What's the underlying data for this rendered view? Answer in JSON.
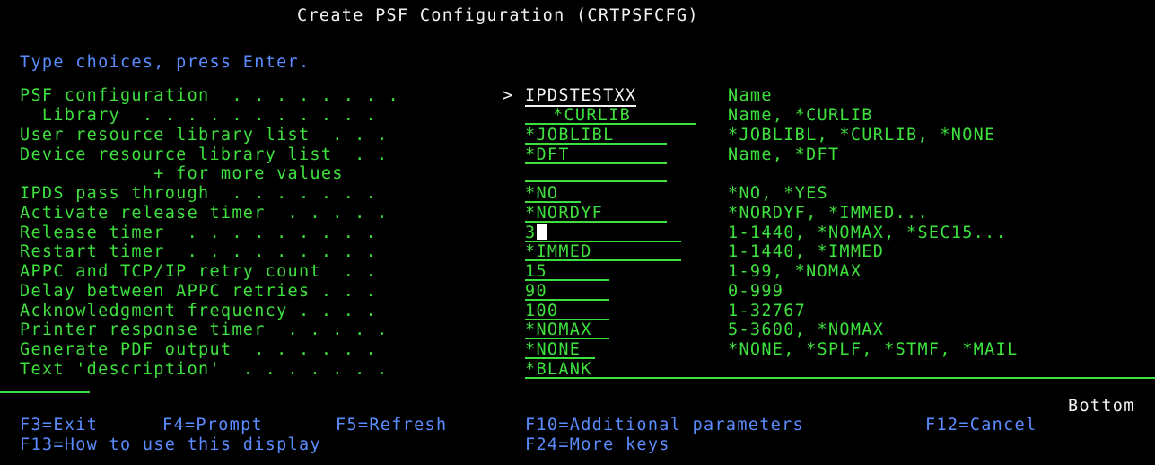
{
  "header": {
    "title": "Create PSF Configuration (CRTPSFCFG)",
    "instruction": "Type choices, press Enter."
  },
  "prompts": [
    {
      "label": "PSF configuration  . . . . . . . .",
      "marker": ">",
      "value": "IPDSTESTXX",
      "hint": "Name"
    },
    {
      "label": "  Library  . . . . . . . . . . .",
      "marker": "",
      "value": "*CURLIB",
      "hint": "Name, *CURLIB"
    },
    {
      "label": "User resource library list  . . .",
      "marker": "",
      "value": "*JOBLIBL",
      "hint": "*JOBLIBL, *CURLIB, *NONE"
    },
    {
      "label": "Device resource library list  . .",
      "marker": "",
      "value": "*DFT",
      "hint": "Name, *DFT"
    },
    {
      "label": "            + for more values",
      "marker": "",
      "value": "",
      "hint": ""
    },
    {
      "label": "IPDS pass through  . . . . . . .",
      "marker": "",
      "value": "*NO",
      "hint": "*NO, *YES"
    },
    {
      "label": "Activate release timer  . . . . .",
      "marker": "",
      "value": "*NORDYF",
      "hint": "*NORDYF, *IMMED..."
    },
    {
      "label": "Release timer  . . . . . . . . .",
      "marker": "",
      "value": "3",
      "hint": "1-1440, *NOMAX, *SEC15..."
    },
    {
      "label": "Restart timer  . . . . . . . . .",
      "marker": "",
      "value": "*IMMED",
      "hint": "1-1440, *IMMED"
    },
    {
      "label": "APPC and TCP/IP retry count  . .",
      "marker": "",
      "value": "15",
      "hint": "1-99, *NOMAX"
    },
    {
      "label": "Delay between APPC retries . . .",
      "marker": "",
      "value": "90",
      "hint": "0-999"
    },
    {
      "label": "Acknowledgment frequency . . . .",
      "marker": "",
      "value": "100",
      "hint": "1-32767"
    },
    {
      "label": "Printer response timer  . . . . .",
      "marker": "",
      "value": "*NOMAX",
      "hint": "5-3600, *NOMAX"
    },
    {
      "label": "Generate PDF output  . . . . . .",
      "marker": "",
      "value": "*NONE",
      "hint": "*NONE, *SPLF, *STMF, *MAIL"
    },
    {
      "label": "Text 'description'  . . . . . . .",
      "marker": "",
      "value": "*BLANK",
      "hint": ""
    }
  ],
  "status": "Bottom",
  "function_keys": {
    "f3": "F3=Exit",
    "f4": "F4=Prompt",
    "f5": "F5=Refresh",
    "f10": "F10=Additional parameters",
    "f12": "F12=Cancel",
    "f13": "F13=How to use this display",
    "f24": "F24=More keys"
  },
  "colors": {
    "background": "#000000",
    "text": "#3ee03e",
    "label": "#5b8cff",
    "title": "#f2f2f2"
  }
}
